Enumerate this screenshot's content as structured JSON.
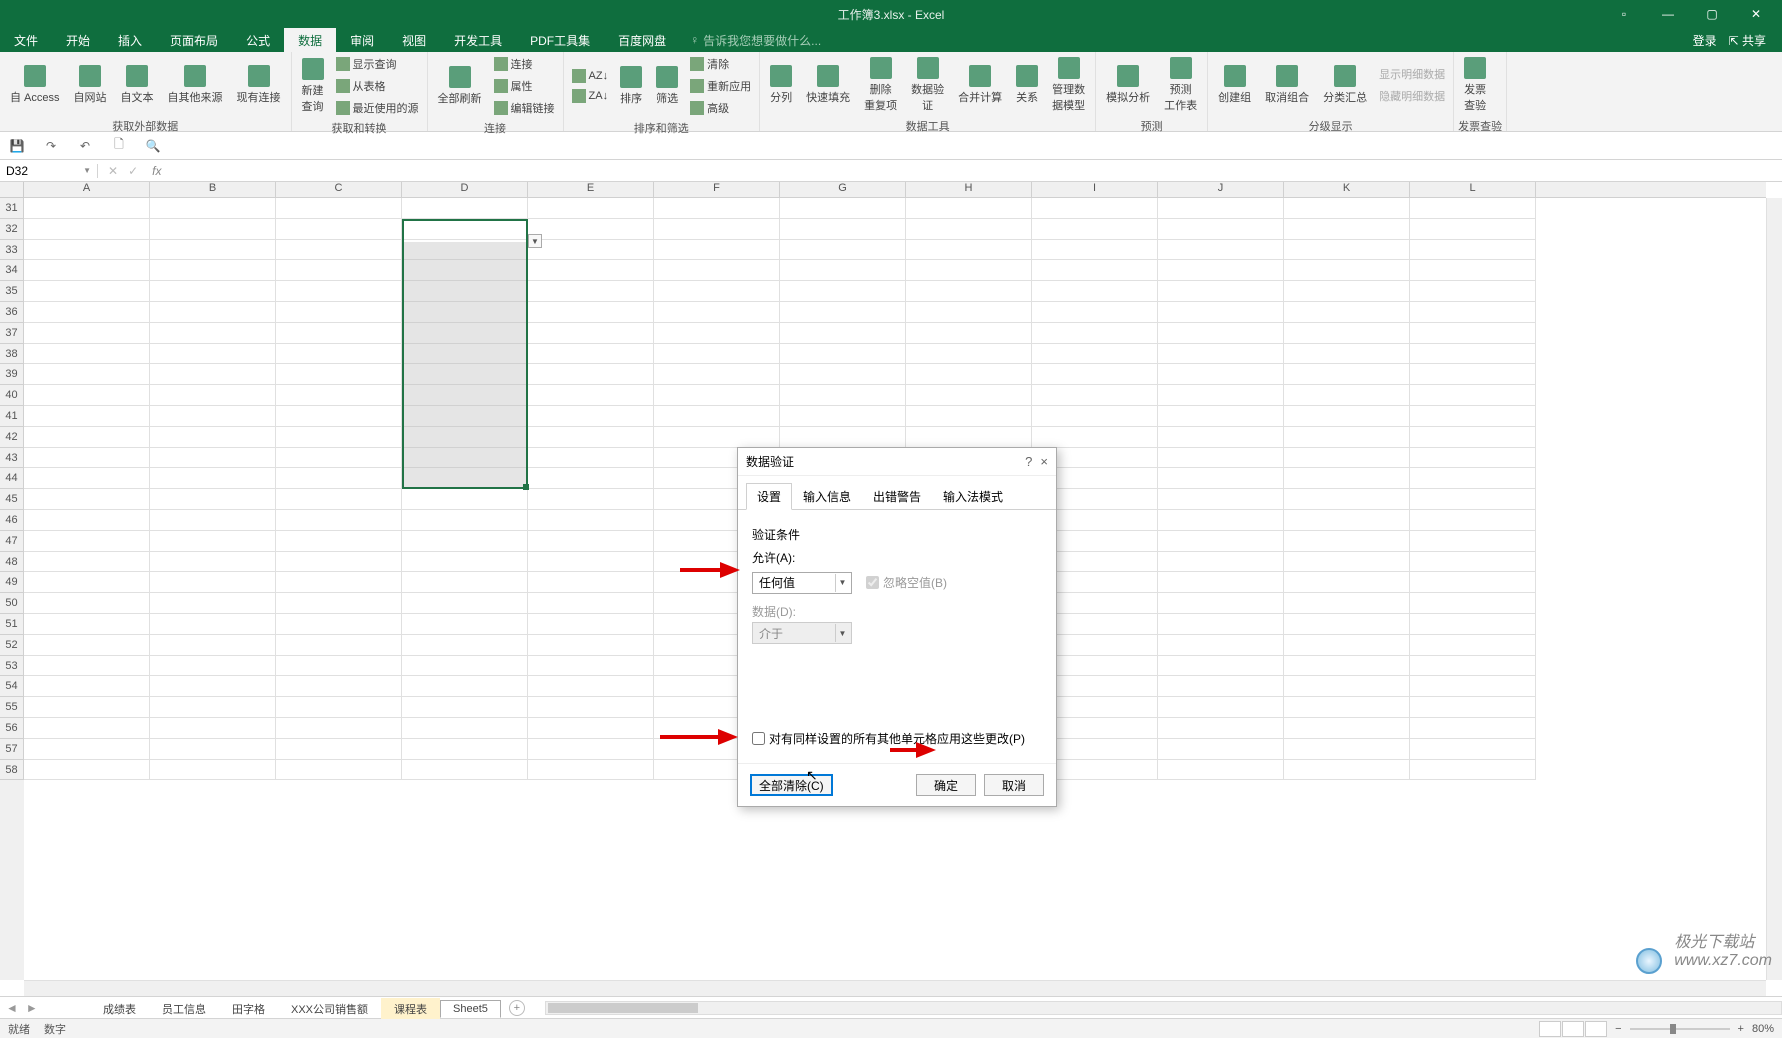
{
  "titlebar": {
    "title": "工作簿3.xlsx - Excel"
  },
  "menubar": {
    "items": [
      "文件",
      "开始",
      "插入",
      "页面布局",
      "公式",
      "数据",
      "审阅",
      "视图",
      "开发工具",
      "PDF工具集",
      "百度网盘"
    ],
    "active_index": 5,
    "tell_me": "告诉我您想要做什么...",
    "login": "登录",
    "share": "共享"
  },
  "ribbon": {
    "groups": [
      {
        "label": "获取外部数据",
        "large": [
          {
            "label": "自 Access"
          },
          {
            "label": "自网站"
          },
          {
            "label": "自文本"
          },
          {
            "label": "自其他来源"
          },
          {
            "label": "现有连接"
          }
        ]
      },
      {
        "label": "获取和转换",
        "large": [
          {
            "label": "新建\n查询"
          }
        ],
        "small": [
          "显示查询",
          "从表格",
          "最近使用的源"
        ]
      },
      {
        "label": "连接",
        "large": [
          {
            "label": "全部刷新"
          }
        ],
        "small": [
          "连接",
          "属性",
          "编辑链接"
        ]
      },
      {
        "label": "排序和筛选",
        "large": [
          {
            "label": "排序"
          },
          {
            "label": "筛选"
          }
        ],
        "small_az": [
          "AZ↓",
          "ZA↓"
        ],
        "small": [
          "清除",
          "重新应用",
          "高级"
        ]
      },
      {
        "label": "数据工具",
        "large": [
          {
            "label": "分列"
          },
          {
            "label": "快速填充"
          },
          {
            "label": "删除\n重复项"
          },
          {
            "label": "数据验\n证"
          },
          {
            "label": "合并计算"
          },
          {
            "label": "关系"
          },
          {
            "label": "管理数\n据模型"
          }
        ]
      },
      {
        "label": "预测",
        "large": [
          {
            "label": "模拟分析"
          },
          {
            "label": "预测\n工作表"
          }
        ]
      },
      {
        "label": "分级显示",
        "large": [
          {
            "label": "创建组"
          },
          {
            "label": "取消组合"
          },
          {
            "label": "分类汇总"
          }
        ],
        "small": [
          "显示明细数据",
          "隐藏明细数据"
        ]
      },
      {
        "label": "发票查验",
        "large": [
          {
            "label": "发票\n查验"
          }
        ]
      }
    ]
  },
  "namebox": "D32",
  "columns": [
    "A",
    "B",
    "C",
    "D",
    "E",
    "F",
    "G",
    "H",
    "I",
    "J",
    "K",
    "L"
  ],
  "rows_start": 31,
  "rows_count": 28,
  "sheet_tabs": {
    "tabs": [
      "成绩表",
      "员工信息",
      "田字格",
      "XXX公司销售额",
      "课程表",
      "Sheet5"
    ],
    "active_index": 5,
    "highlight_index": 4
  },
  "statusbar": {
    "left": [
      "就绪",
      "数字"
    ],
    "zoom": "80%"
  },
  "dialog": {
    "title": "数据验证",
    "help": "?",
    "close": "×",
    "tabs": [
      "设置",
      "输入信息",
      "出错警告",
      "输入法模式"
    ],
    "active_tab": 0,
    "section_label": "验证条件",
    "allow_label": "允许(A):",
    "allow_value": "任何值",
    "ignore_blank": "忽略空值(B)",
    "data_label": "数据(D):",
    "data_value": "介于",
    "apply_label": "对有同样设置的所有其他单元格应用这些更改(P)",
    "clear": "全部清除(C)",
    "ok": "确定",
    "cancel": "取消"
  },
  "watermark": "极光下载站\nwww.xz7.com"
}
